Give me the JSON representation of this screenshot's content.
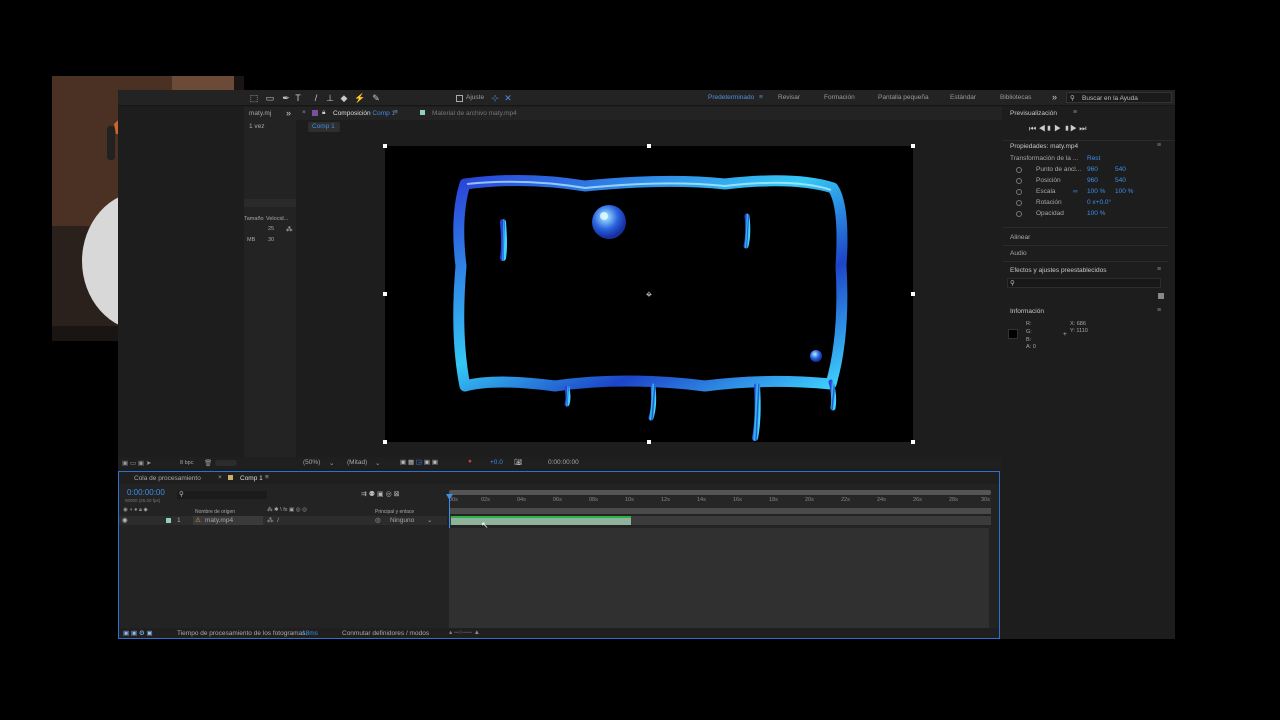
{
  "toolbar": {
    "ajuste_label": "Ajuste",
    "workspaces": [
      "Predeterminado",
      "Revisar",
      "Formación",
      "Pantalla pequeña",
      "Estándar",
      "Bibliotecas"
    ],
    "search_placeholder": "Buscar en la Ayuda",
    "more_glyph": "»"
  },
  "project": {
    "file_label": "maty.mj",
    "uses": "1 vez",
    "col_size": "Tamaño",
    "col_speed": "Velocid...",
    "size_value": "MB",
    "speed_value": "25",
    "speed_value2": "30",
    "bpc": "8 bpc"
  },
  "comp_tabs": {
    "composition_prefix": "Composición",
    "composition_name": "Comp 1",
    "footage_prefix": "Material de archivo",
    "footage_name": "maty.mp4",
    "breadcrumb": "Comp 1"
  },
  "viewer": {
    "zoom": "(50%)",
    "resolution": "(Mitad)",
    "exposure": "+0.0",
    "timecode": "0:00:00:00"
  },
  "preview": {
    "title": "Previsualización"
  },
  "properties": {
    "title": "Propiedades: maty.mp4",
    "group_label": "Transformación de la ...",
    "reset_label": "Rest",
    "rows": [
      {
        "name": "Punto de ancl...",
        "v1": "960",
        "v2": "540"
      },
      {
        "name": "Posición",
        "v1": "960",
        "v2": "540"
      },
      {
        "name": "Escala",
        "v1": "100 %",
        "v2": "100 %"
      },
      {
        "name": "Rotación",
        "v1": "0 x+0.0°",
        "v2": ""
      },
      {
        "name": "Opacidad",
        "v1": "100 %",
        "v2": ""
      }
    ]
  },
  "side_sections": {
    "align": "Alinear",
    "audio": "Audio",
    "effects": "Efectos y ajustes preestablecidos",
    "info": "Información"
  },
  "info": {
    "r": "R:",
    "g": "G:",
    "b": "B:",
    "a": "A: 0",
    "x": "X: 686",
    "y": "Y: 1110"
  },
  "timeline": {
    "tab_queue": "Cola de procesamiento",
    "tab_comp": "Comp 1",
    "timecode": "0:00:00:00",
    "frames_info": "00000 (25.00 fps)",
    "col_source": "Nombre de origen",
    "col_parent": "Principal y enlace",
    "layer_number": "1",
    "layer_name": "maty.mp4",
    "parent_value": "Ninguno",
    "ruler": [
      "00s",
      "02s",
      "04s",
      "06s",
      "08s",
      "10s",
      "12s",
      "14s",
      "16s",
      "18s",
      "20s",
      "22s",
      "24s",
      "26s",
      "28s",
      "30s"
    ],
    "footer_label": "Tiempo de procesamiento de los fotogramas:",
    "footer_value": "18ms",
    "toggle_label": "Conmutar definidores / modos"
  },
  "colors": {
    "accent": "#3d8fe8",
    "layer_bar": "#8fb39a",
    "work_area": "#2bb34a",
    "panel_outline": "#2f6fd0"
  }
}
